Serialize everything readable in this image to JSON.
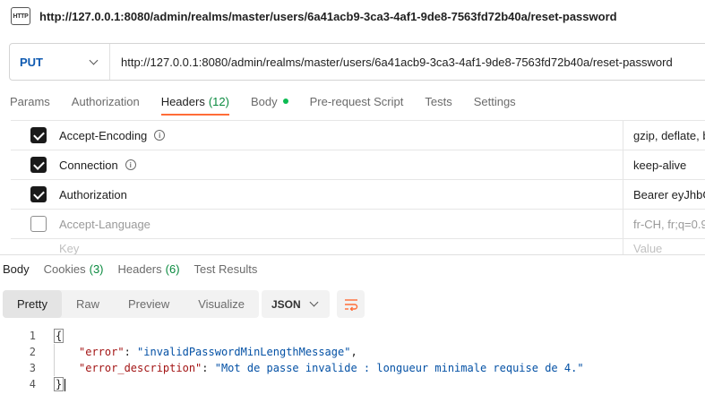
{
  "title_bar": {
    "badge": "HTTP",
    "url": "http://127.0.0.1:8080/admin/realms/master/users/6a41acb9-3ca3-4af1-9de8-7563fd72b40a/reset-password"
  },
  "request": {
    "method": "PUT",
    "url": "http://127.0.0.1:8080/admin/realms/master/users/6a41acb9-3ca3-4af1-9de8-7563fd72b40a/reset-password"
  },
  "request_tabs": [
    {
      "label": "Params"
    },
    {
      "label": "Authorization"
    },
    {
      "label": "Headers",
      "count": "(12)"
    },
    {
      "label": "Body"
    },
    {
      "label": "Pre-request Script"
    },
    {
      "label": "Tests"
    },
    {
      "label": "Settings"
    }
  ],
  "headers": [
    {
      "key": "Accept-Encoding",
      "value": "gzip, deflate, b",
      "checked": true
    },
    {
      "key": "Connection",
      "value": "keep-alive",
      "checked": true
    },
    {
      "key": "Authorization",
      "value": "Bearer eyJhbG",
      "checked": true
    },
    {
      "key": "Accept-Language",
      "value": "fr-CH, fr;q=0.9",
      "checked": false
    },
    {
      "key_placeholder": "Key",
      "value_placeholder": "Value"
    }
  ],
  "response_tabs": [
    {
      "label": "Body"
    },
    {
      "label": "Cookies",
      "count": "(3)"
    },
    {
      "label": "Headers",
      "count": "(6)"
    },
    {
      "label": "Test Results"
    }
  ],
  "view_modes": [
    "Pretty",
    "Raw",
    "Preview",
    "Visualize"
  ],
  "format": "JSON",
  "code": {
    "line_numbers": [
      "1",
      "2",
      "3",
      "4"
    ],
    "open_brace": "{",
    "close_brace": "}",
    "line2_key": "\"error\"",
    "line2_colon": ": ",
    "line2_value": "\"invalidPasswordMinLengthMessage\"",
    "line2_comma": ",",
    "line3_key": "\"error_description\"",
    "line3_colon": ": ",
    "line3_value": "\"Mot de passe invalide : longueur minimale requise de 4.\""
  },
  "colors": {
    "method": "#0f5ab1",
    "active_tab_underline": "#ff6c37",
    "count_green": "#0a8a3f",
    "json_key": "#a31515",
    "json_string": "#0451a5"
  }
}
